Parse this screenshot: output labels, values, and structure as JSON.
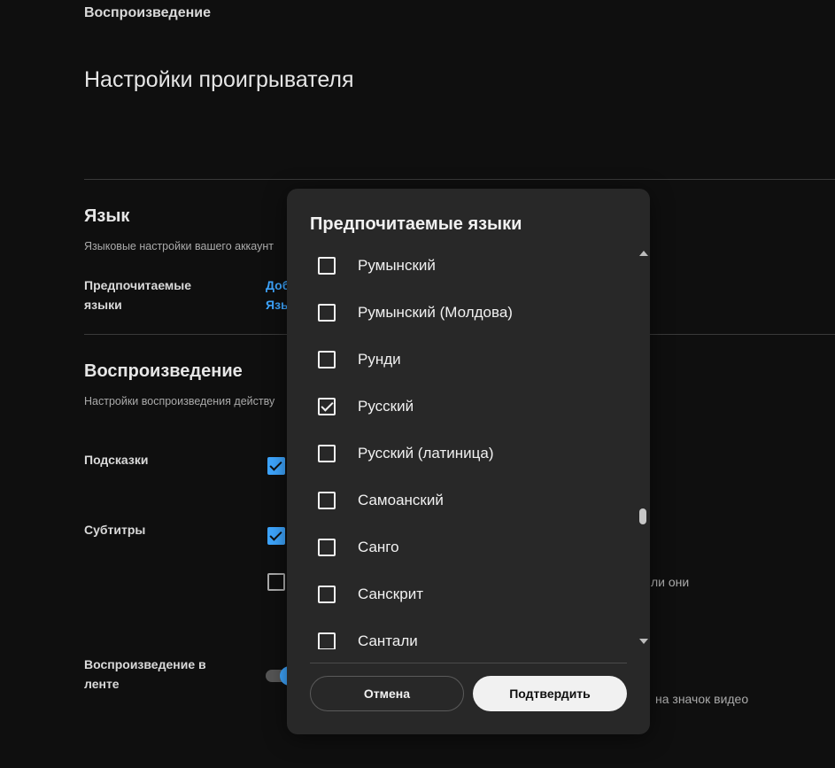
{
  "page": {
    "breadcrumb": "Воспроизведение",
    "title": "Настройки проигрывателя"
  },
  "language_section": {
    "title": "Язык",
    "description": "Языковые настройки вашего аккаунт",
    "preferred_label": "Предпочитаемые\nязыки",
    "link_line1": "Доб",
    "link_line2": "Язы"
  },
  "playback_section": {
    "title": "Воспроизведение",
    "description": "Настройки воспроизведения действу",
    "hints_label": "Подсказки",
    "subtitles_label": "Субтитры",
    "subtitles_partial_text": "ли они",
    "feed_label": "Воспроизведение в\nленте",
    "feed_partial_text": "на значок видео"
  },
  "dialog": {
    "title": "Предпочитаемые языки",
    "languages": [
      {
        "label": "Румынский",
        "checked": false
      },
      {
        "label": "Румынский (Молдова)",
        "checked": false
      },
      {
        "label": "Рунди",
        "checked": false
      },
      {
        "label": "Русский",
        "checked": true
      },
      {
        "label": "Русский (латиница)",
        "checked": false
      },
      {
        "label": "Самоанский",
        "checked": false
      },
      {
        "label": "Санго",
        "checked": false
      },
      {
        "label": "Санскрит",
        "checked": false
      },
      {
        "label": "Сантали",
        "checked": false
      }
    ],
    "cancel_label": "Отмена",
    "confirm_label": "Подтвердить"
  },
  "colors": {
    "background": "#0f0f0f",
    "dialog_bg": "#282828",
    "accent": "#3ea6ff",
    "confirm_bg": "#f1f1f1"
  },
  "icons": {
    "scroll_up": "triangle-up-icon",
    "scroll_down": "triangle-down-icon",
    "checkmark": "checkmark-icon"
  }
}
